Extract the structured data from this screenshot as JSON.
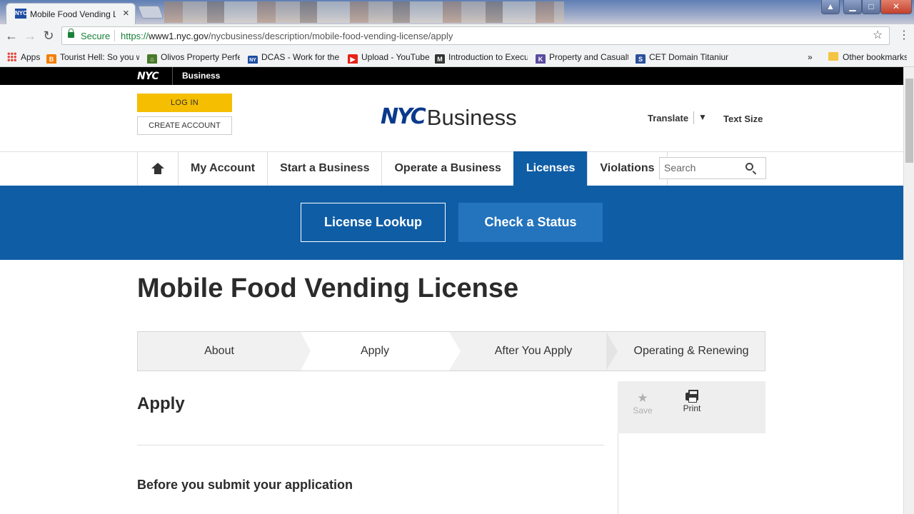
{
  "browser": {
    "tab_title": "Mobile Food Vending Lic",
    "tab_favicon": "NYC",
    "secure_label": "Secure",
    "url_scheme": "https://",
    "url_host": "www1.nyc.gov",
    "url_path": "/nycbusiness/description/mobile-food-vending-license/apply",
    "bookmarks": [
      {
        "label": "Apps",
        "icon": "apps-grid-icon"
      },
      {
        "label": "Tourist Hell: So you w",
        "icon": "blogger-icon",
        "color": "#f57d00"
      },
      {
        "label": "Olivos Property Perfe",
        "icon": "property-icon",
        "color": "#4a7a2a"
      },
      {
        "label": "DCAS - Work for the",
        "icon": "nyc-icon",
        "color": "#1e4ea3"
      },
      {
        "label": "Upload - YouTube",
        "icon": "youtube-icon",
        "color": "#e62117"
      },
      {
        "label": "Introduction to Execu",
        "icon": "book-icon",
        "color": "#333333"
      },
      {
        "label": "Property and Casualty",
        "icon": "k-icon",
        "color": "#5b4ba0"
      },
      {
        "label": "CET Domain Titanium",
        "icon": "s-icon",
        "color": "#2a4f9c"
      }
    ],
    "overflow": "»",
    "other_bookmarks": "Other bookmarks"
  },
  "site": {
    "top_logo": "NYC",
    "top_label": "Business",
    "login": "LOG IN",
    "create_account": "CREATE ACCOUNT",
    "brand_nyc": "NYC",
    "brand_business": "Business",
    "translate": "Translate",
    "translate_arrow": "▼",
    "text_size": "Text Size",
    "nav": [
      "My Account",
      "Start a Business",
      "Operate a Business",
      "Licenses",
      "Violations"
    ],
    "active_nav": "Licenses",
    "search_placeholder": "Search",
    "license_lookup": "License Lookup",
    "check_status": "Check a Status",
    "page_title": "Mobile Food Vending License",
    "steps": [
      "About",
      "Apply",
      "After You Apply",
      "Operating & Renewing"
    ],
    "current_step": "Apply",
    "section_title": "Apply",
    "subsection_title": "Before you submit your application",
    "tool_save": "Save",
    "tool_print": "Print"
  },
  "colors": {
    "nyc_blue": "#0f5da5",
    "login_yellow": "#f5be00",
    "brand_navy": "#0a3a8c"
  }
}
